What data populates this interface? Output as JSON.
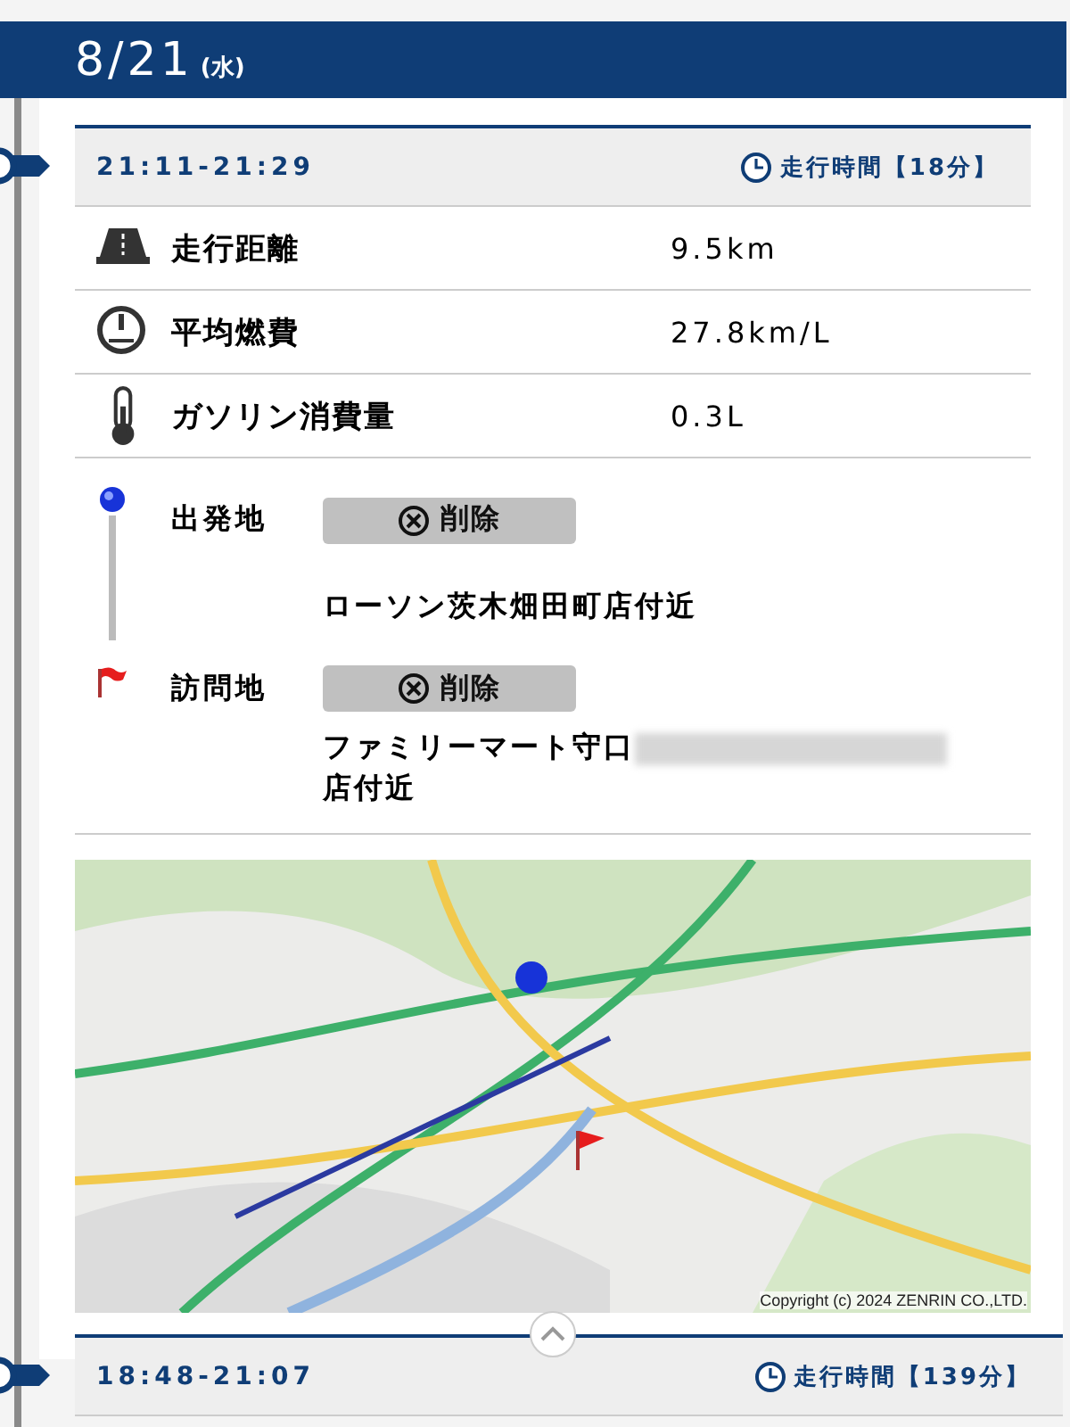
{
  "date": {
    "day": "8/21",
    "weekday": "(水)"
  },
  "trips": [
    {
      "expanded": true,
      "time_range": "21:11-21:29",
      "duration": "走行時間【18分】",
      "stats": [
        {
          "kind": "distance",
          "label": "走行距離",
          "value": "9.5km"
        },
        {
          "kind": "fuel_economy",
          "label": "平均燃費",
          "value": "27.8km/L"
        },
        {
          "kind": "fuel_used",
          "label": "ガソリン消費量",
          "value": "0.3L"
        }
      ],
      "places": [
        {
          "kind": "origin",
          "label": "出発地",
          "delete_button": "削除",
          "address": "ローソン茨木畑田町店付近",
          "redacted": false
        },
        {
          "kind": "destination",
          "label": "訪問地",
          "delete_button": "削除",
          "address": "ファミリーマート守口",
          "redacted": true,
          "address_end": "店付近"
        }
      ],
      "map": {
        "kind": "picture",
        "copyright": "Copyright (c) 2024 ZENRIN CO.,LTD."
      }
    },
    {
      "expanded": false,
      "time_range": "18:48-21:07",
      "duration": "走行時間【139分】"
    }
  ]
}
